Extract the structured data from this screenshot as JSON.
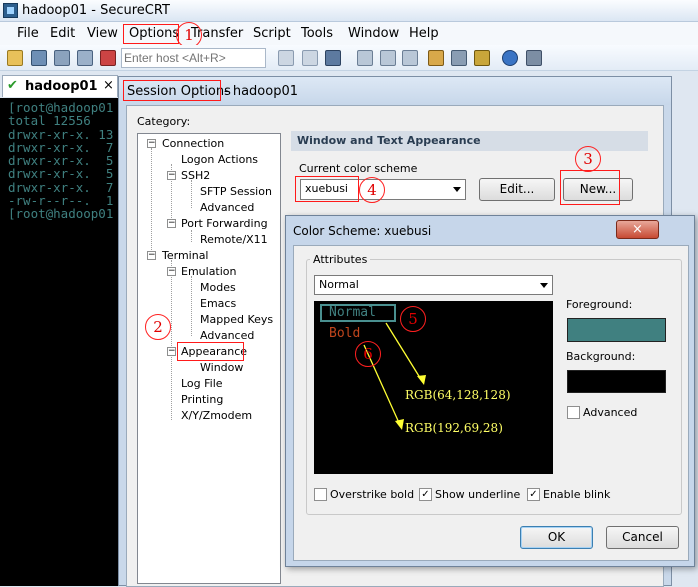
{
  "window": {
    "title": "hadoop01 - SecureCRT"
  },
  "menu": {
    "items": [
      "File",
      "Edit",
      "View",
      "Options",
      "Transfer",
      "Script",
      "Tools",
      "Window",
      "Help"
    ]
  },
  "toolbar": {
    "host_placeholder": "Enter host <Alt+R>"
  },
  "tab": {
    "label": "hadoop01",
    "close": "×"
  },
  "terminal": {
    "lines": [
      "[root@hadoop01",
      "total 12556",
      "drwxr-xr-x. 13",
      "drwxr-xr-x.  7",
      "drwxr-xr-x.  5",
      "drwxr-xr-x.  5",
      "drwxr-xr-x.  7",
      "-rw-r--r--.  1",
      "[root@hadoop01"
    ]
  },
  "session_dialog": {
    "title_highlight": "Session Options",
    "title_rest": " - hadoop01",
    "category_label": "Category:",
    "tree": [
      "Connection",
      "Logon Actions",
      "SSH2",
      "SFTP Session",
      "Advanced",
      "Port Forwarding",
      "Remote/X11",
      "Terminal",
      "Emulation",
      "Modes",
      "Emacs",
      "Mapped Keys",
      "Advanced",
      "Appearance",
      "Window",
      "Log File",
      "Printing",
      "X/Y/Zmodem"
    ],
    "section_header": "Window and Text Appearance",
    "current_scheme_label": "Current color scheme",
    "current_scheme_value": "xuebusi",
    "edit_button": "Edit...",
    "new_button": "New..."
  },
  "color_dialog": {
    "title": "Color Scheme: xuebusi",
    "attributes_label": "Attributes",
    "attributes_value": "Normal",
    "preview_normal": "Normal",
    "preview_bold": "Bold",
    "rgb_normal": "RGB(64,128,128)",
    "rgb_bold": "RGB(192,69,28)",
    "foreground_label": "Foreground:",
    "foreground_color": "#408080",
    "background_label": "Background:",
    "background_color": "#000000",
    "advanced_label": "Advanced",
    "overstrike_label": "Overstrike bold",
    "underline_label": "Show underline",
    "blink_label": "Enable blink",
    "ok_button": "OK",
    "cancel_button": "Cancel",
    "close_button": "×"
  },
  "annotations": [
    "1",
    "2",
    "3",
    "4",
    "5",
    "6"
  ],
  "colors": {
    "annotation_red": "#ff1a1a",
    "text_normal": "#408080",
    "text_bold": "#c0451c",
    "rgb_label": "#ffff66"
  }
}
